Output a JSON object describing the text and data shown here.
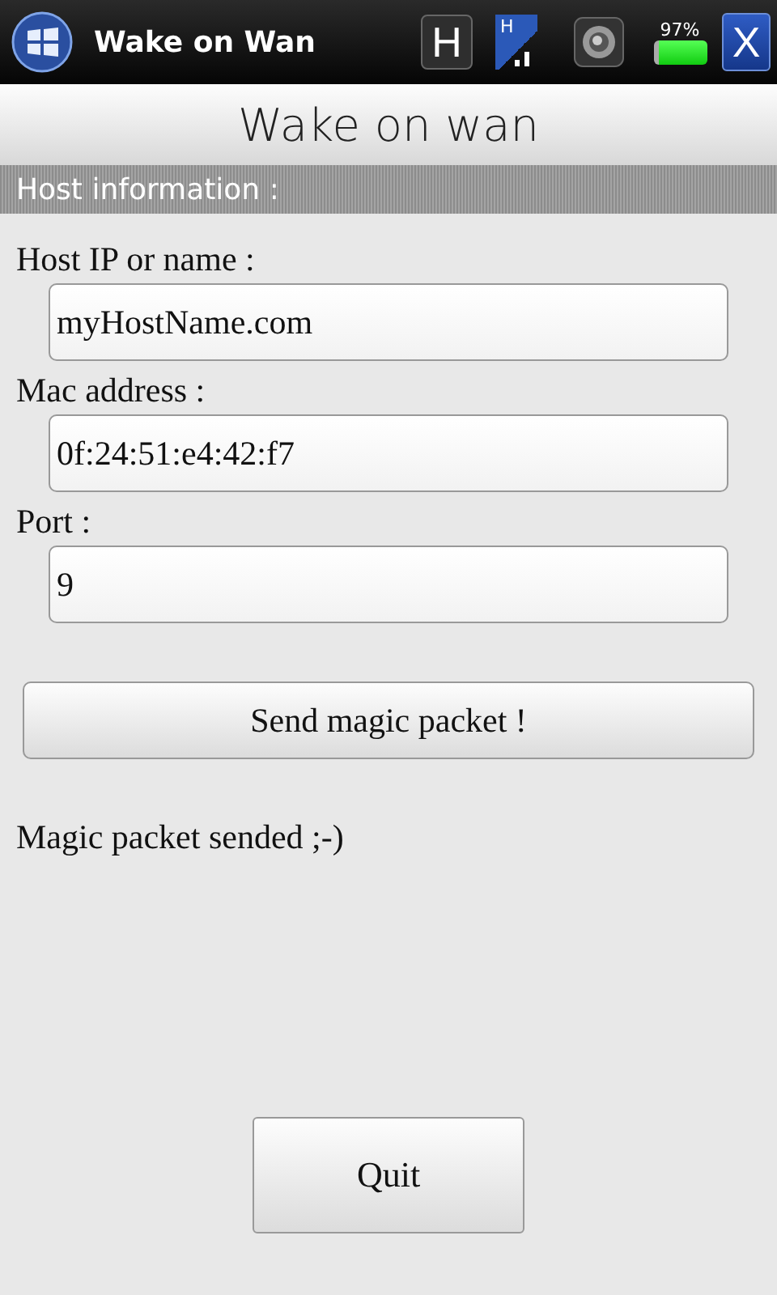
{
  "status_bar": {
    "title": "Wake on Wan",
    "network_letter": "H",
    "signal_letter": "H",
    "battery": "97%",
    "close": "X"
  },
  "header": {
    "title": "Wake on wan"
  },
  "section": {
    "title": "Host information :"
  },
  "fields": [
    {
      "label": "Host IP or name :",
      "value": "myHostName.com"
    },
    {
      "label": "Mac address :",
      "value": "0f:24:51:e4:42:f7"
    },
    {
      "label": "Port :",
      "value": "9"
    }
  ],
  "send_button": "Send magic packet !",
  "status_message": "Magic packet sended ;-)",
  "quit_button": "Quit"
}
